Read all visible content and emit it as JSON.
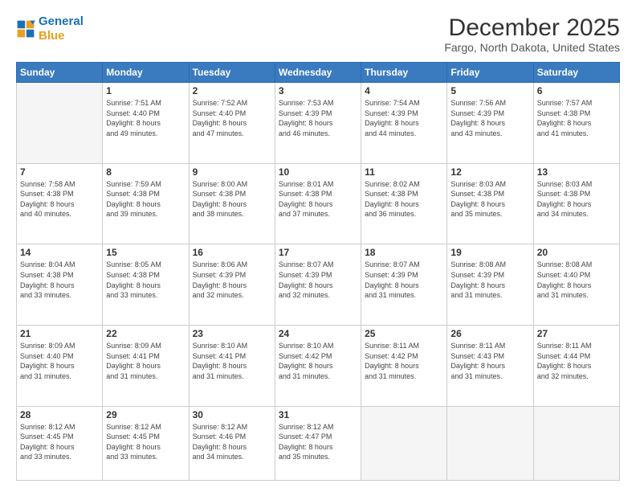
{
  "header": {
    "logo_line1": "General",
    "logo_line2": "Blue",
    "title": "December 2025",
    "subtitle": "Fargo, North Dakota, United States"
  },
  "days_of_week": [
    "Sunday",
    "Monday",
    "Tuesday",
    "Wednesday",
    "Thursday",
    "Friday",
    "Saturday"
  ],
  "weeks": [
    [
      {
        "day": "",
        "info": ""
      },
      {
        "day": "1",
        "info": "Sunrise: 7:51 AM\nSunset: 4:40 PM\nDaylight: 8 hours\nand 49 minutes."
      },
      {
        "day": "2",
        "info": "Sunrise: 7:52 AM\nSunset: 4:40 PM\nDaylight: 8 hours\nand 47 minutes."
      },
      {
        "day": "3",
        "info": "Sunrise: 7:53 AM\nSunset: 4:39 PM\nDaylight: 8 hours\nand 46 minutes."
      },
      {
        "day": "4",
        "info": "Sunrise: 7:54 AM\nSunset: 4:39 PM\nDaylight: 8 hours\nand 44 minutes."
      },
      {
        "day": "5",
        "info": "Sunrise: 7:56 AM\nSunset: 4:39 PM\nDaylight: 8 hours\nand 43 minutes."
      },
      {
        "day": "6",
        "info": "Sunrise: 7:57 AM\nSunset: 4:38 PM\nDaylight: 8 hours\nand 41 minutes."
      }
    ],
    [
      {
        "day": "7",
        "info": "Sunrise: 7:58 AM\nSunset: 4:38 PM\nDaylight: 8 hours\nand 40 minutes."
      },
      {
        "day": "8",
        "info": "Sunrise: 7:59 AM\nSunset: 4:38 PM\nDaylight: 8 hours\nand 39 minutes."
      },
      {
        "day": "9",
        "info": "Sunrise: 8:00 AM\nSunset: 4:38 PM\nDaylight: 8 hours\nand 38 minutes."
      },
      {
        "day": "10",
        "info": "Sunrise: 8:01 AM\nSunset: 4:38 PM\nDaylight: 8 hours\nand 37 minutes."
      },
      {
        "day": "11",
        "info": "Sunrise: 8:02 AM\nSunset: 4:38 PM\nDaylight: 8 hours\nand 36 minutes."
      },
      {
        "day": "12",
        "info": "Sunrise: 8:03 AM\nSunset: 4:38 PM\nDaylight: 8 hours\nand 35 minutes."
      },
      {
        "day": "13",
        "info": "Sunrise: 8:03 AM\nSunset: 4:38 PM\nDaylight: 8 hours\nand 34 minutes."
      }
    ],
    [
      {
        "day": "14",
        "info": "Sunrise: 8:04 AM\nSunset: 4:38 PM\nDaylight: 8 hours\nand 33 minutes."
      },
      {
        "day": "15",
        "info": "Sunrise: 8:05 AM\nSunset: 4:38 PM\nDaylight: 8 hours\nand 33 minutes."
      },
      {
        "day": "16",
        "info": "Sunrise: 8:06 AM\nSunset: 4:39 PM\nDaylight: 8 hours\nand 32 minutes."
      },
      {
        "day": "17",
        "info": "Sunrise: 8:07 AM\nSunset: 4:39 PM\nDaylight: 8 hours\nand 32 minutes."
      },
      {
        "day": "18",
        "info": "Sunrise: 8:07 AM\nSunset: 4:39 PM\nDaylight: 8 hours\nand 31 minutes."
      },
      {
        "day": "19",
        "info": "Sunrise: 8:08 AM\nSunset: 4:39 PM\nDaylight: 8 hours\nand 31 minutes."
      },
      {
        "day": "20",
        "info": "Sunrise: 8:08 AM\nSunset: 4:40 PM\nDaylight: 8 hours\nand 31 minutes."
      }
    ],
    [
      {
        "day": "21",
        "info": "Sunrise: 8:09 AM\nSunset: 4:40 PM\nDaylight: 8 hours\nand 31 minutes."
      },
      {
        "day": "22",
        "info": "Sunrise: 8:09 AM\nSunset: 4:41 PM\nDaylight: 8 hours\nand 31 minutes."
      },
      {
        "day": "23",
        "info": "Sunrise: 8:10 AM\nSunset: 4:41 PM\nDaylight: 8 hours\nand 31 minutes."
      },
      {
        "day": "24",
        "info": "Sunrise: 8:10 AM\nSunset: 4:42 PM\nDaylight: 8 hours\nand 31 minutes."
      },
      {
        "day": "25",
        "info": "Sunrise: 8:11 AM\nSunset: 4:42 PM\nDaylight: 8 hours\nand 31 minutes."
      },
      {
        "day": "26",
        "info": "Sunrise: 8:11 AM\nSunset: 4:43 PM\nDaylight: 8 hours\nand 31 minutes."
      },
      {
        "day": "27",
        "info": "Sunrise: 8:11 AM\nSunset: 4:44 PM\nDaylight: 8 hours\nand 32 minutes."
      }
    ],
    [
      {
        "day": "28",
        "info": "Sunrise: 8:12 AM\nSunset: 4:45 PM\nDaylight: 8 hours\nand 33 minutes."
      },
      {
        "day": "29",
        "info": "Sunrise: 8:12 AM\nSunset: 4:45 PM\nDaylight: 8 hours\nand 33 minutes."
      },
      {
        "day": "30",
        "info": "Sunrise: 8:12 AM\nSunset: 4:46 PM\nDaylight: 8 hours\nand 34 minutes."
      },
      {
        "day": "31",
        "info": "Sunrise: 8:12 AM\nSunset: 4:47 PM\nDaylight: 8 hours\nand 35 minutes."
      },
      {
        "day": "",
        "info": ""
      },
      {
        "day": "",
        "info": ""
      },
      {
        "day": "",
        "info": ""
      }
    ]
  ]
}
